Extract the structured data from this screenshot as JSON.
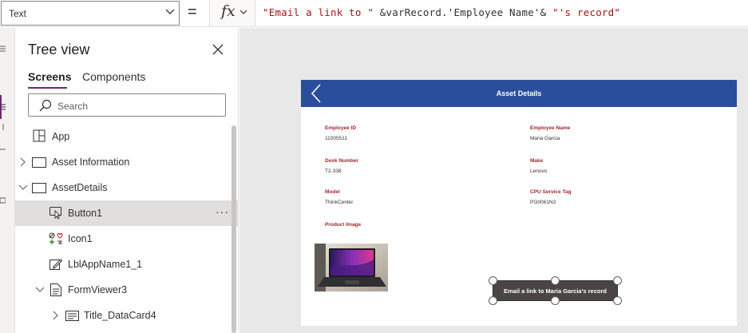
{
  "formula_bar": {
    "property": "Text",
    "equals": "=",
    "fx_label": "fx",
    "formula_part1": "\"Email a link to \"",
    "formula_part2": " &varRecord.'Employee Name'& ",
    "formula_part3": "\"'s record\""
  },
  "tree_view": {
    "title": "Tree view",
    "tabs": [
      "Screens",
      "Components"
    ],
    "search_placeholder": "Search",
    "items": [
      {
        "label": "App",
        "icon": "app-icon"
      },
      {
        "label": "Asset Information",
        "icon": "screen-icon"
      },
      {
        "label": "AssetDetails",
        "icon": "screen-icon"
      },
      {
        "label": "Button1",
        "icon": "button-icon"
      },
      {
        "label": "Icon1",
        "icon": "icons-icon"
      },
      {
        "label": "LblAppName1_1",
        "icon": "label-icon"
      },
      {
        "label": "FormViewer3",
        "icon": "form-icon"
      },
      {
        "label": "Title_DataCard4",
        "icon": "card-icon"
      }
    ],
    "more_label": "···"
  },
  "app_screen": {
    "header_title": "Asset Details",
    "fields": [
      {
        "label": "Employee ID",
        "value": "11005511"
      },
      {
        "label": "Employee Name",
        "value": "Maria Garcia"
      },
      {
        "label": "Desk Number",
        "value": "T2-338"
      },
      {
        "label": "Make",
        "value": "Lenovo"
      },
      {
        "label": "Model",
        "value": "ThinkCenter"
      },
      {
        "label": "CPU Service Tag",
        "value": "PG0061N3"
      },
      {
        "label": "Product Image",
        "value": ""
      }
    ],
    "email_button_label": "Email a link to Maria Garcia's record"
  },
  "colors": {
    "accent": "#742774",
    "app_header": "#2a4e9c",
    "field_label": "#a4262c",
    "formula_string": "#a31515"
  }
}
